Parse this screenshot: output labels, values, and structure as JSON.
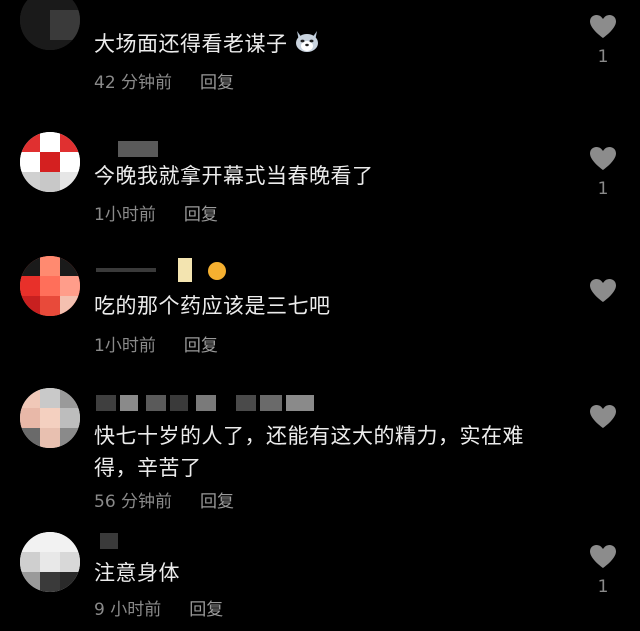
{
  "comments": [
    {
      "text": "大场面还得看老谋子",
      "emoji": "wolf-face",
      "time": "42 分钟前",
      "reply_label": "回复",
      "likes": "1"
    },
    {
      "text": "今晚我就拿开幕式当春晚看了",
      "time": "1小时前",
      "reply_label": "回复",
      "likes": "1"
    },
    {
      "text": "吃的那个药应该是三七吧",
      "time": "1小时前",
      "reply_label": "回复",
      "likes": ""
    },
    {
      "text_line1": "快七十岁的人了，还能有这大的精力，实在难",
      "text_line2": "得，辛苦了",
      "time": "56 分钟前",
      "reply_label": "回复",
      "likes": ""
    },
    {
      "text": "注意身体",
      "time": "9 小时前",
      "reply_label": "回复",
      "likes": "1"
    }
  ],
  "colors": {
    "background": "#000000",
    "text": "#ececec",
    "meta": "#8a8a8a",
    "heart": "#8c8c8c"
  },
  "icons": {
    "like": "heart-icon",
    "avatar": "pixelated-avatar"
  }
}
